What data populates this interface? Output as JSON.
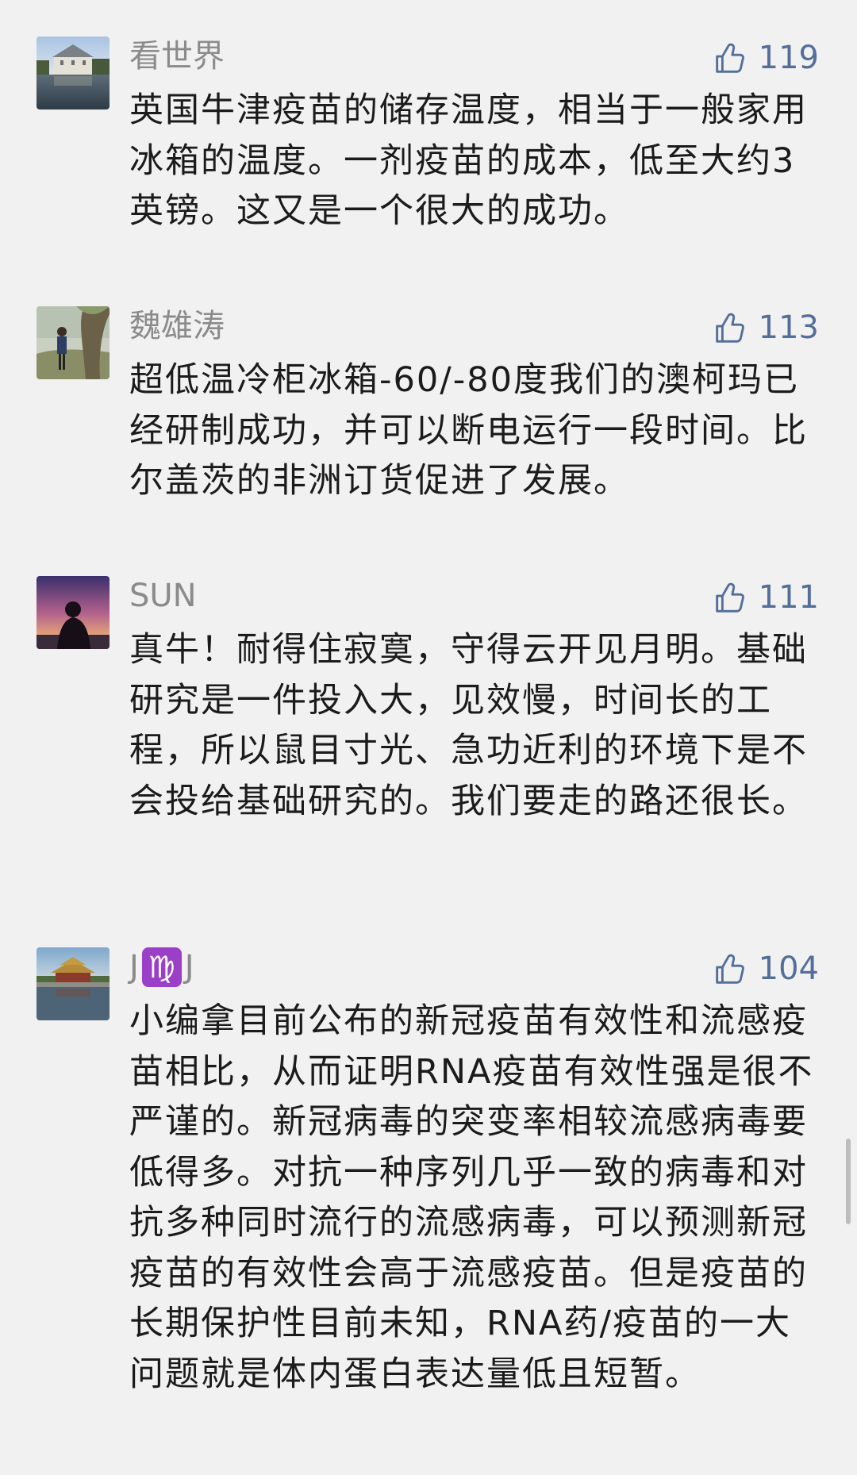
{
  "comments": [
    {
      "author": "看世界",
      "likes": "119",
      "avatar": "lake-castle-photo",
      "text": "英国牛津疫苗的储存温度，相当于一般家用冰箱的温度。一剂疫苗的成本，低至大约3英镑。这又是一个很大的成功。"
    },
    {
      "author": "魏雄涛",
      "likes": "113",
      "avatar": "person-by-tree-photo",
      "text": "超低温冷柜冰箱-60/-80度我们的澳柯玛已经研制成功，并可以断电运行一段时间。比尔盖茨的非洲订货促进了发展。"
    },
    {
      "author": "SUN",
      "likes": "111",
      "avatar": "sunset-silhouette-photo",
      "text": "真牛！耐得住寂寞，守得云开见月明。基础研究是一件投入大，见效慢，时间长的工程，所以鼠目寸光、急功近利的环境下是不会投给基础研究的。我们要走的路还很长。"
    },
    {
      "author_prefix": "J",
      "author_symbol": "♍",
      "author_suffix": "J",
      "likes": "104",
      "avatar": "palace-moat-photo",
      "text": "小编拿目前公布的新冠疫苗有效性和流感疫苗相比，从而证明RNA疫苗有效性强是很不严谨的。新冠病毒的突变率相较流感病毒要低得多。对抗一种序列几乎一致的病毒和对抗多种同时流行的流感病毒，可以预测新冠疫苗的有效性会高于流感疫苗。但是疫苗的长期保护性目前未知，RNA药/疫苗的一大问题就是体内蛋白表达量低且短暂。"
    }
  ],
  "colors": {
    "background": "#f1f1f1",
    "author": "#8b8b8b",
    "like": "#546e9a",
    "text": "#1b1b1b",
    "zodiac_badge": "#9b3fc8"
  }
}
